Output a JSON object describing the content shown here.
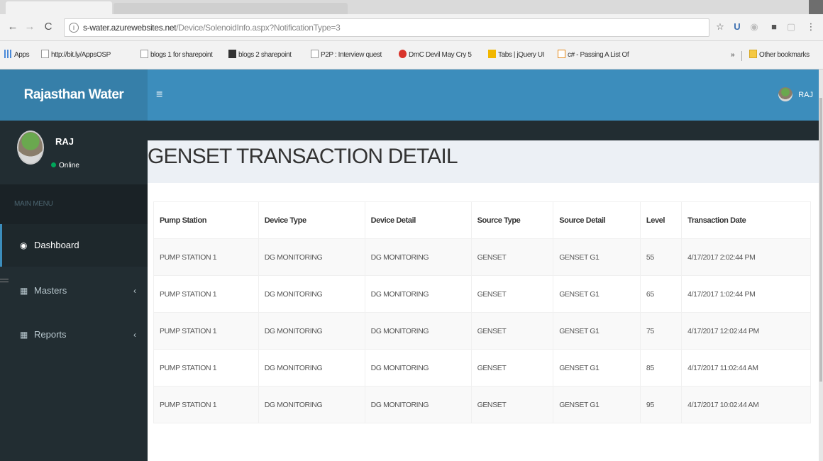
{
  "browser": {
    "url_host": "s-water.azurewebsites.net",
    "url_path": "/Device/SolenoidInfo.aspx?NotificationType=3",
    "bookmarks": [
      {
        "label": "Apps",
        "icon": "apps-icon"
      },
      {
        "label": "http://bit.ly/AppsOSP",
        "icon": "page-icon"
      },
      {
        "label": "blogs 1 for sharepoint",
        "icon": "page-icon"
      },
      {
        "label": "blogs 2 sharepoint",
        "icon": "m-icon"
      },
      {
        "label": "P2P : Interview quest",
        "icon": "page-icon"
      },
      {
        "label": "DmC Devil May Cry 5",
        "icon": "red-circle-icon"
      },
      {
        "label": "Tabs | jQuery UI",
        "icon": "jquery-icon"
      },
      {
        "label": "c# - Passing A List Of",
        "icon": "stack-icon"
      }
    ],
    "more_bookmarks": "»",
    "other_bookmarks": "Other bookmarks"
  },
  "app": {
    "brand": "Rajasthan Water",
    "user_name": "RAJ",
    "user_status": "Online",
    "menu_header": "MAIN MENU",
    "menu": [
      {
        "label": "Dashboard",
        "icon": "dashboard-icon",
        "active": true
      },
      {
        "label": "Masters",
        "icon": "table-icon",
        "chevron": "‹"
      },
      {
        "label": "Reports",
        "icon": "table-icon",
        "chevron": "‹"
      }
    ],
    "nav_user": "RAJ"
  },
  "page": {
    "title": "GENSET TRANSACTION DETAIL"
  },
  "table": {
    "columns": [
      "Pump Station",
      "Device Type",
      "Device Detail",
      "Source Type",
      "Source Detail",
      "Level",
      "Transaction Date"
    ],
    "rows": [
      [
        "PUMP STATION 1",
        "DG MONITORING",
        "DG MONITORING",
        "GENSET",
        "GENSET G1",
        "55",
        "4/17/2017 2:02:44 PM"
      ],
      [
        "PUMP STATION 1",
        "DG MONITORING",
        "DG MONITORING",
        "GENSET",
        "GENSET G1",
        "65",
        "4/17/2017 1:02:44 PM"
      ],
      [
        "PUMP STATION 1",
        "DG MONITORING",
        "DG MONITORING",
        "GENSET",
        "GENSET G1",
        "75",
        "4/17/2017 12:02:44 PM"
      ],
      [
        "PUMP STATION 1",
        "DG MONITORING",
        "DG MONITORING",
        "GENSET",
        "GENSET G1",
        "85",
        "4/17/2017 11:02:44 AM"
      ],
      [
        "PUMP STATION 1",
        "DG MONITORING",
        "DG MONITORING",
        "GENSET",
        "GENSET G1",
        "95",
        "4/17/2017 10:02:44 AM"
      ]
    ]
  },
  "colors": {
    "logo_bg": "#367fa9",
    "navbar_bg": "#3c8dbc",
    "sidebar_bg": "#222d32",
    "online": "#00a65a"
  }
}
